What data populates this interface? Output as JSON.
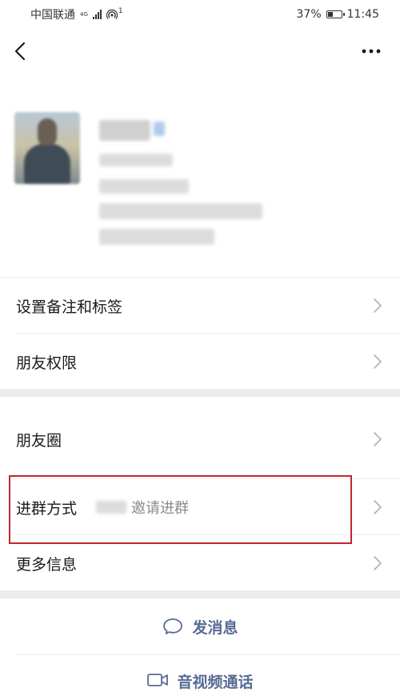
{
  "status_bar": {
    "carrier": "中国联通",
    "network": "4G",
    "hotspot": "1",
    "battery_percent": "37%",
    "time": "11:45",
    "battery_level": 0.37
  },
  "nav": {
    "back_icon": "chevron-left-icon",
    "more_icon": "more-dots-icon"
  },
  "menu": {
    "remark_tags": "设置备注和标签",
    "permissions": "朋友权限",
    "moments": "朋友圈",
    "join_method_label": "进群方式",
    "join_method_value": "邀请进群",
    "more_info": "更多信息"
  },
  "actions": {
    "send_message": "发消息",
    "video_call": "音视频通话"
  },
  "colors": {
    "link_blue": "#576b95",
    "highlight_red": "#c0272d",
    "divider": "#ededed"
  }
}
